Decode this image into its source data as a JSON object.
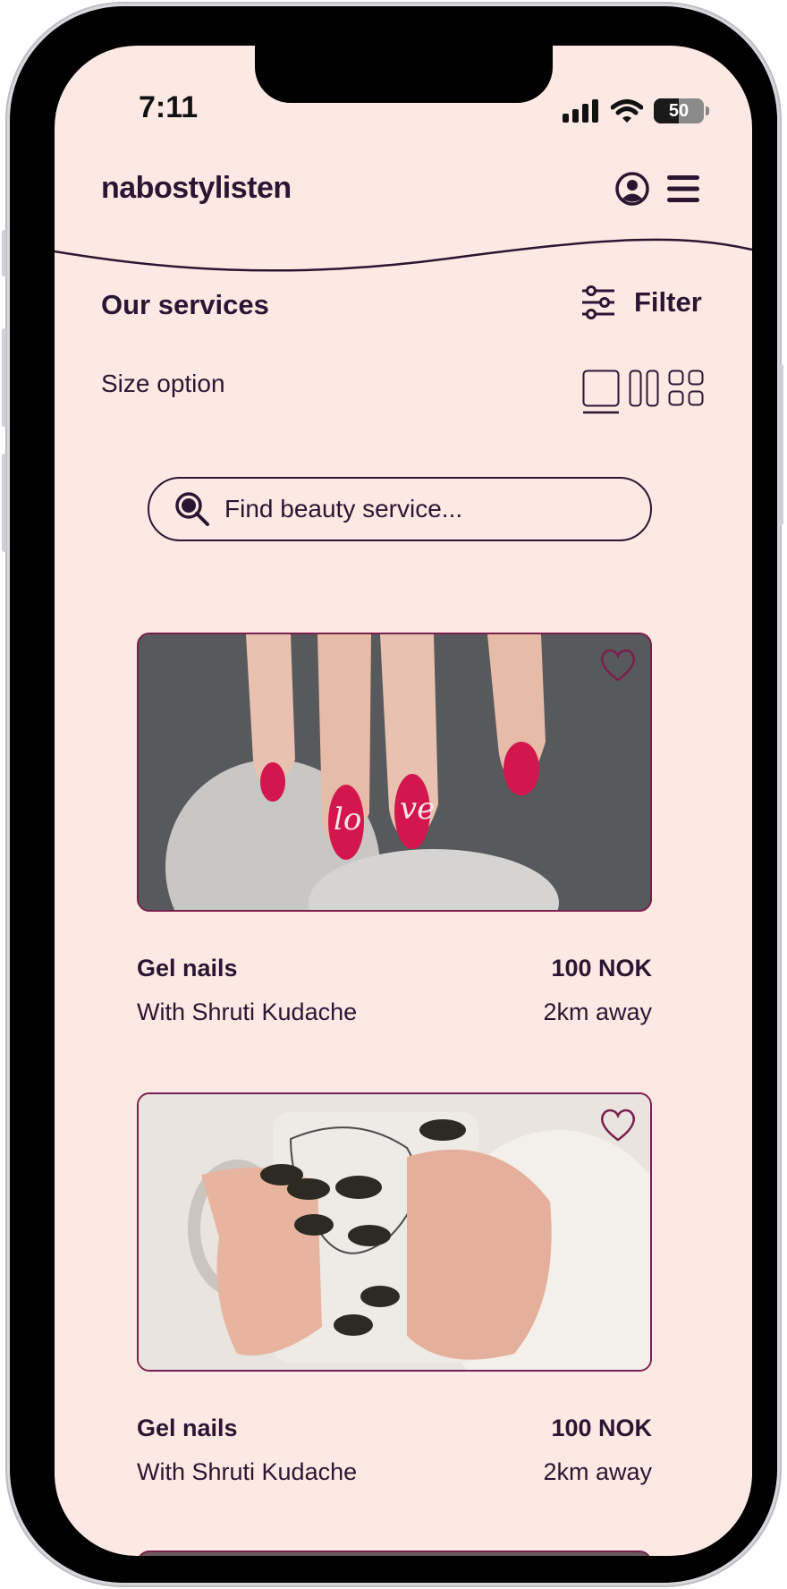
{
  "status_bar": {
    "time": "7:11",
    "battery": "50",
    "battery_level": 0.5
  },
  "header": {
    "brand": "nabostylisten",
    "icons": [
      "account-icon",
      "menu-icon"
    ]
  },
  "page": {
    "title": "Our services",
    "filter_label": "Filter",
    "size_option_label": "Size option",
    "size_options": [
      "single-column-icon",
      "two-column-icon",
      "grid-icon"
    ],
    "selected_size_option": "single-column-icon"
  },
  "search": {
    "placeholder": "Find beauty service..."
  },
  "services": [
    {
      "image": "red-love-nails-photo",
      "title": "Gel nails",
      "price": "100 NOK",
      "stylist": "With Shruti Kudache",
      "distance": "2km away"
    },
    {
      "image": "dark-nails-mug-photo",
      "title": "Gel nails",
      "price": "100 NOK",
      "stylist": "With Shruti Kudache",
      "distance": "2km away"
    }
  ],
  "colors": {
    "background": "#fde9e3",
    "text": "#2a1633",
    "card_border": "#7a1f4d",
    "accent_red": "#d3174e"
  }
}
